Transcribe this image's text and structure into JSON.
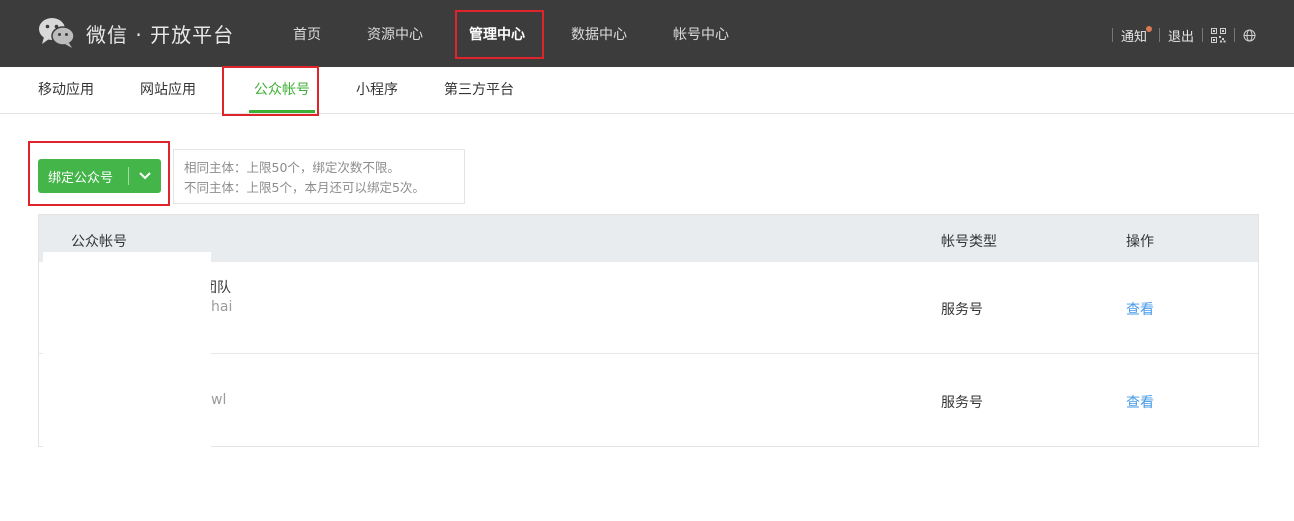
{
  "header": {
    "logo_icon": "wechat-logo-icon",
    "title": "微信 · 开放平台",
    "nav": [
      {
        "label": "首页",
        "active": false
      },
      {
        "label": "资源中心",
        "active": false
      },
      {
        "label": "管理中心",
        "active": true
      },
      {
        "label": "数据中心",
        "active": false
      },
      {
        "label": "帐号中心",
        "active": false
      }
    ],
    "tools": {
      "notify_label": "通知",
      "logout_label": "退出",
      "qr_icon": "qrcode-icon",
      "globe_icon": "globe-icon"
    }
  },
  "subnav": {
    "items": [
      {
        "label": "移动应用",
        "active": false
      },
      {
        "label": "网站应用",
        "active": false
      },
      {
        "label": "公众帐号",
        "active": true
      },
      {
        "label": "小程序",
        "active": false
      },
      {
        "label": "第三方平台",
        "active": false
      }
    ]
  },
  "bind": {
    "button_label": "绑定公众号",
    "dropdown_icon": "chevron-down-icon",
    "tip_line1": "相同主体：上限50个，绑定次数不限。",
    "tip_line2": "不同主体：上限5个，本月还可以绑定5次。"
  },
  "table": {
    "headers": {
      "account": "公众帐号",
      "type": "帐号类型",
      "action": "操作"
    },
    "rows": [
      {
        "name_visible": "团队",
        "sub_visible": "hai",
        "type": "服务号",
        "action": "查看"
      },
      {
        "name_visible": "",
        "sub_visible": "wl",
        "type": "服务号",
        "action": "查看"
      }
    ]
  },
  "colors": {
    "topbar": "#3c3c3c",
    "accent_green": "#44b549",
    "link_blue": "#459ae9",
    "highlight_red": "#e0242c"
  }
}
